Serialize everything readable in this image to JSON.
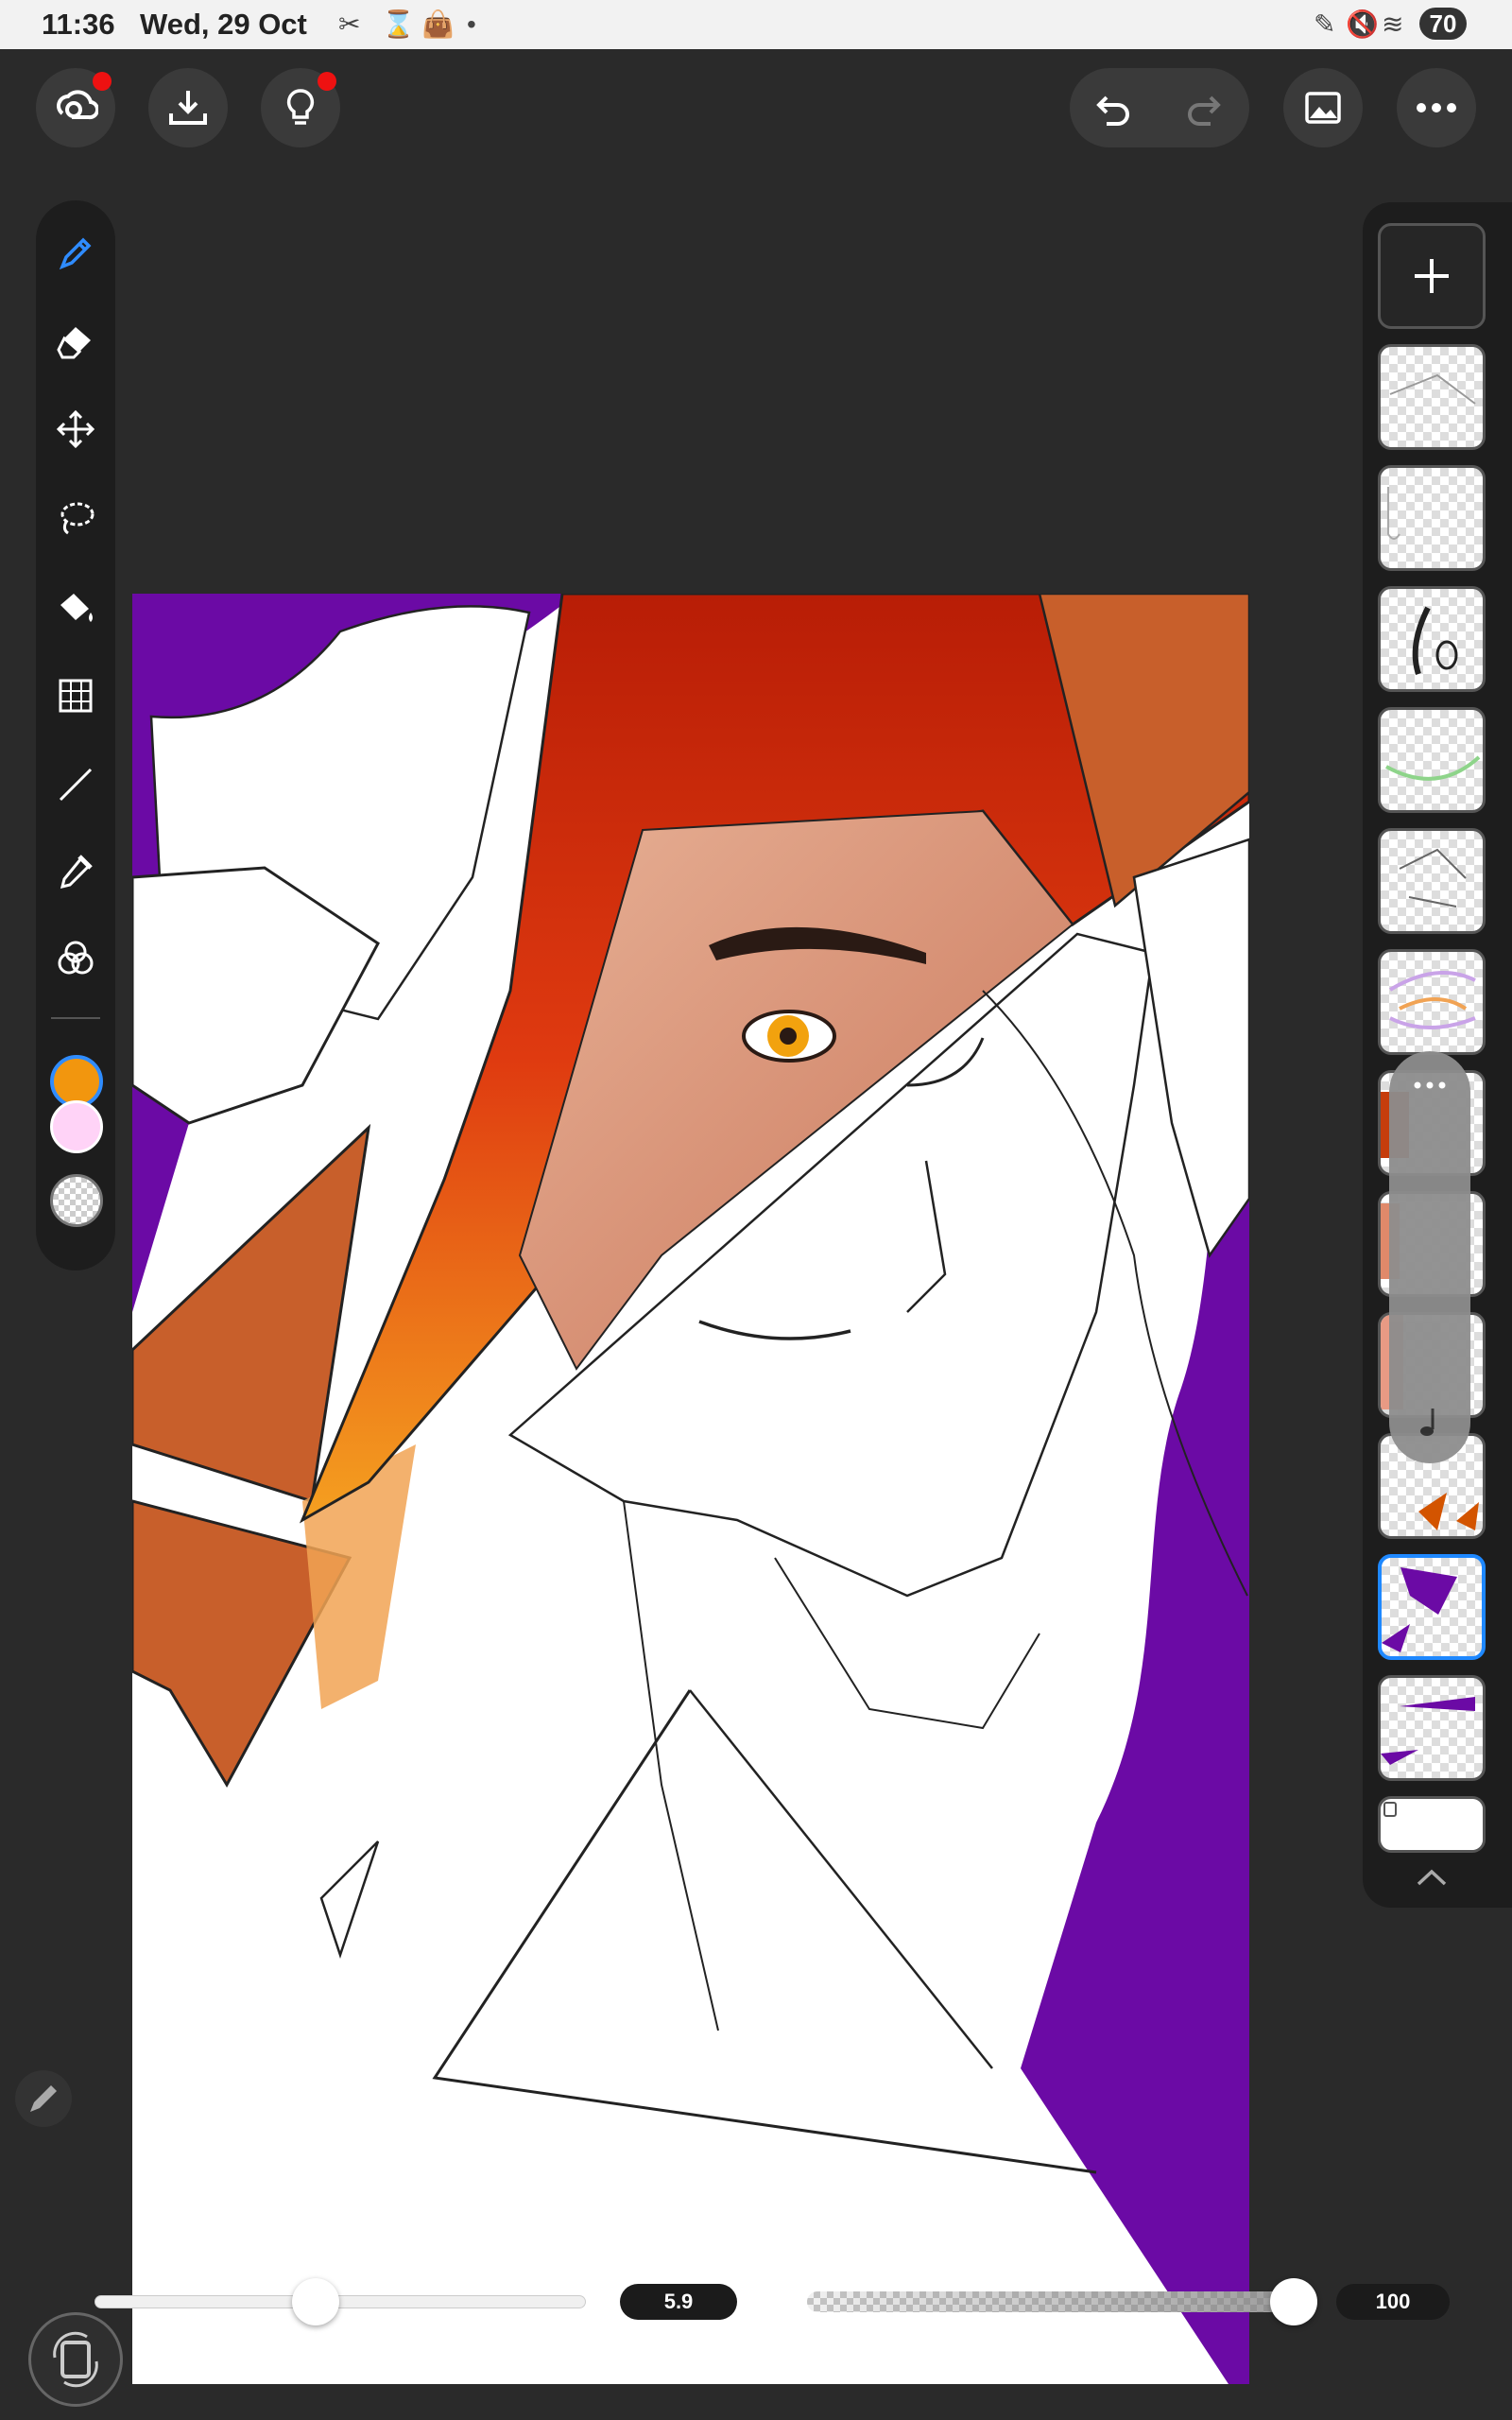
{
  "status_bar": {
    "time": "11:36",
    "date": "Wed, 29 Oct",
    "battery": "70",
    "icons": [
      "tools-icon",
      "timer-icon",
      "shopping-bag-icon",
      "dot-icon",
      "stylus-icon",
      "mute-icon",
      "wifi-icon"
    ]
  },
  "toolbar": {
    "left": [
      "creative-cloud-icon",
      "import-icon",
      "lightbulb-icon"
    ],
    "right": [
      "undo-icon",
      "redo-icon",
      "image-icon",
      "more-icon"
    ]
  },
  "tools": {
    "items": [
      "pen-icon",
      "eraser-icon",
      "move-icon",
      "lasso-icon",
      "fill-icon",
      "grid-transform-icon",
      "line-icon",
      "eyedropper-icon",
      "color-blend-icon"
    ],
    "active": "pen-icon"
  },
  "colors": {
    "primary": "#f2960e",
    "secondary": "#ffd3f7",
    "accent": "#1e88ff",
    "artwork_purple": "#6b0aa5",
    "artwork_orange": "#c85f2b",
    "artwork_red": "#d22d0e"
  },
  "layers": {
    "count": 12,
    "selected_index": 10,
    "menu_icon": "more-icon",
    "music_icon": "music-note-icon"
  },
  "bottom": {
    "brush_size": "5.9",
    "brush_size_fraction": 0.45,
    "opacity": "100",
    "opacity_fraction": 1.0
  }
}
